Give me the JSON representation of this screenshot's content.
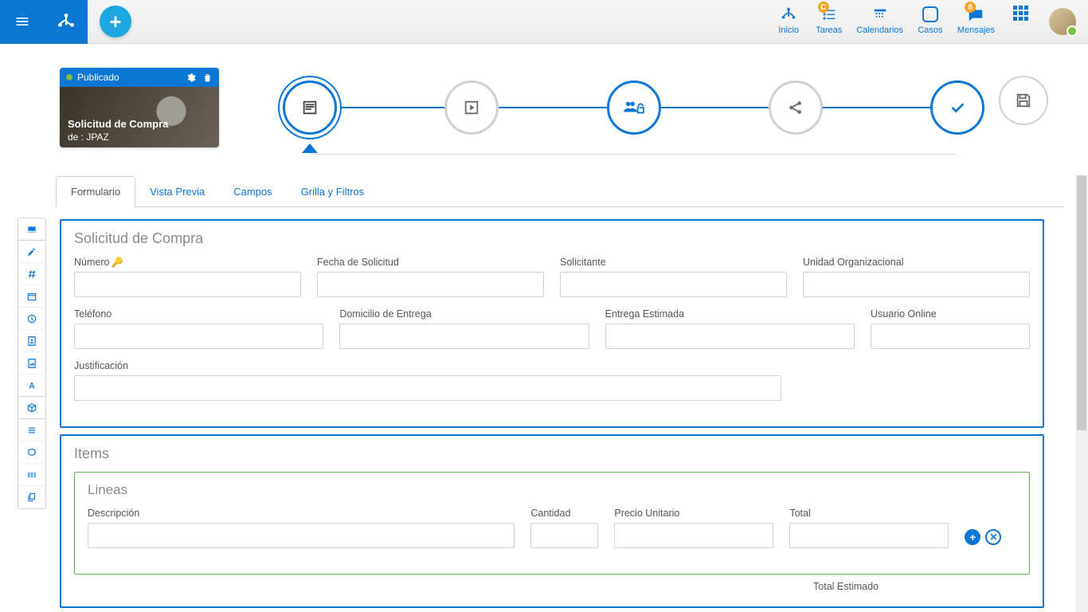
{
  "topnav": {
    "inicio": "Inicio",
    "tareas": "Tareas",
    "calendarios": "Calendarios",
    "casos": "Casos",
    "mensajes": "Mensajes",
    "tareas_badge": "C",
    "mensajes_badge": "8"
  },
  "card": {
    "status": "Publicado",
    "title": "Solicitud de Compra",
    "subtitle": "de : JPAZ"
  },
  "tabs": {
    "formulario": "Formulario",
    "vista_previa": "Vista Previa",
    "campos": "Campos",
    "grilla": "Grilla y Filtros"
  },
  "form": {
    "section1_title": "Solicitud de Compra",
    "numero": "Número",
    "fecha": "Fecha de Solicitud",
    "solicitante": "Solicitante",
    "unidad": "Unidad Organizacional",
    "telefono": "Teléfono",
    "domicilio": "Domicilio de Entrega",
    "entrega_est": "Entrega Estimada",
    "usuario": "Usuario Online",
    "justificacion": "Justificación",
    "section2_title": "Items",
    "lineas_title": "Lineas",
    "descripcion": "Descripción",
    "cantidad": "Cantidad",
    "precio": "Precio Unitario",
    "total": "Total",
    "total_estimado": "Total Estimado"
  }
}
